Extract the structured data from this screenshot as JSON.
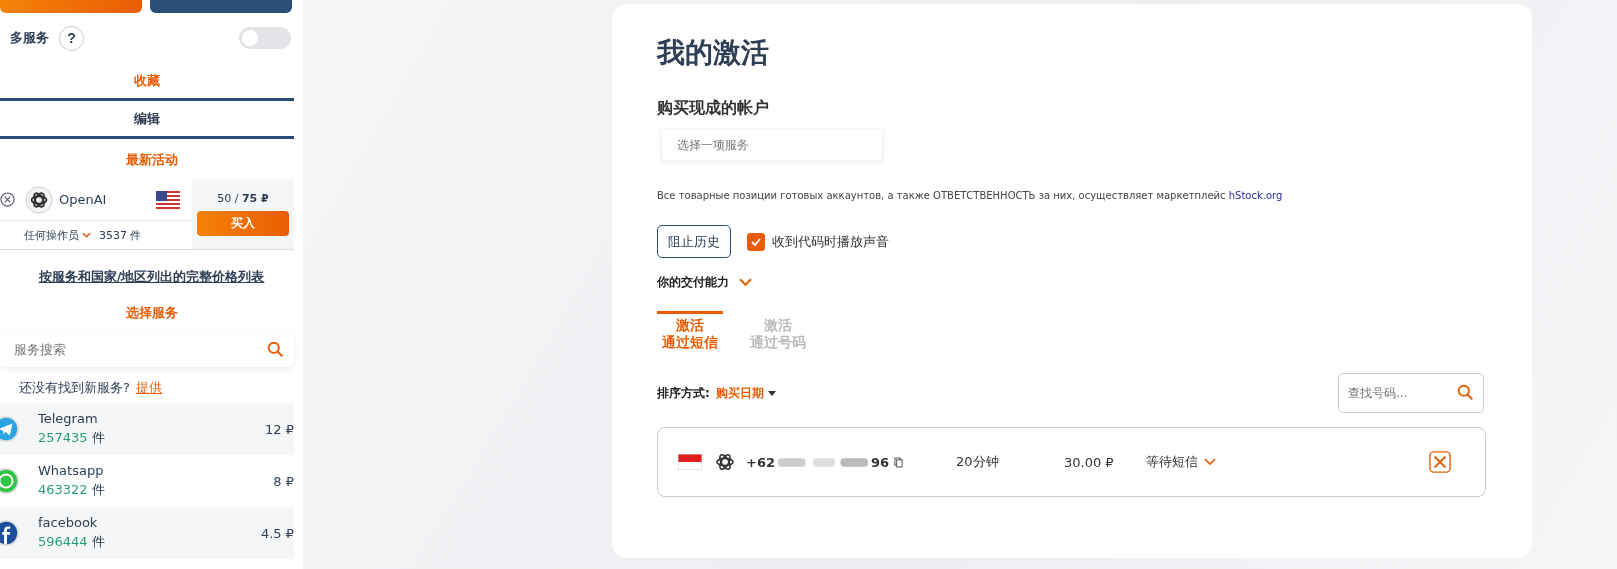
{
  "sidebar": {
    "multi_service": {
      "label": "多服务",
      "help": "?",
      "on": false
    },
    "tabs": [
      {
        "label": "收藏",
        "selected": true
      },
      {
        "label": "编辑",
        "selected": false
      }
    ],
    "recent": {
      "title": "最新活动",
      "service": "OpenAI",
      "operator": "任何操作员",
      "count": "3537 件",
      "price_current": "50",
      "price_sep": " / ",
      "price_full": "75 ₽",
      "buy": "买入"
    },
    "price_list_link": "按服务和国家/地区列出的完整价格列表",
    "choose_title": "选择服务",
    "search": {
      "placeholder": "服务搜索"
    },
    "suggest": {
      "text": "还没有找到新服务?",
      "link": "提供"
    },
    "services": [
      {
        "name": "Telegram",
        "count": "257435",
        "unit": "件",
        "price": "12 ₽",
        "kind": "telegram"
      },
      {
        "name": "Whatsapp",
        "count": "463322",
        "unit": "件",
        "price": "8 ₽",
        "kind": "whatsapp"
      },
      {
        "name": "facebook",
        "count": "596444",
        "unit": "件",
        "price": "4.5 ₽",
        "kind": "facebook"
      }
    ]
  },
  "main": {
    "title": "我的激活",
    "subtitle": "购买现成的帐户",
    "select": {
      "placeholder": "选择一项服务"
    },
    "notice": {
      "text": "Все товарные позиции готовых аккаунтов, а также ОТВЕТСТВЕННОСТЬ за них, осуществляет маркетплейс ",
      "link": "hStock.org"
    },
    "block_history": "阻止历史",
    "sound": {
      "label": "收到代码时播放声音",
      "checked": true
    },
    "capability": "你的交付能力",
    "tabs": [
      {
        "line1": "激活",
        "line2": "通过短信",
        "selected": true
      },
      {
        "line1": "激活",
        "line2": "通过号码",
        "selected": false
      }
    ],
    "sort": {
      "label": "排序方式:",
      "value": "购买日期"
    },
    "number_search": {
      "placeholder": "查找号码..."
    },
    "activations": [
      {
        "phone_start": "+62",
        "phone_end": "96",
        "duration": "20分钟",
        "price": "30.00 ₽",
        "status": "等待短信"
      }
    ]
  }
}
